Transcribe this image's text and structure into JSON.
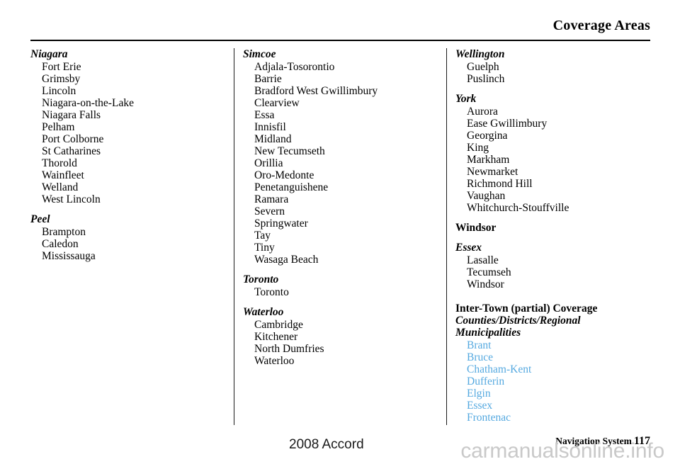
{
  "header": {
    "title": "Coverage Areas"
  },
  "columns": [
    {
      "id": "left",
      "sections": [
        {
          "heading": "Niagara",
          "heading_style": "county",
          "items": [
            "Fort Erie",
            "Grimsby",
            "Lincoln",
            "Niagara-on-the-Lake",
            "Niagara Falls",
            "Pelham",
            "Port Colborne",
            "St Catharines",
            "Thorold",
            "Wainfleet",
            "Welland",
            "West Lincoln"
          ]
        },
        {
          "heading": "Peel",
          "heading_style": "county",
          "items": [
            "Brampton",
            "Caledon",
            "Mississauga"
          ]
        }
      ]
    },
    {
      "id": "middle",
      "sections": [
        {
          "heading": "Simcoe",
          "heading_style": "county",
          "items": [
            "Adjala-Tosorontio",
            "Barrie",
            "Bradford West Gwillimbury",
            "Clearview",
            "Essa",
            "Innisfil",
            "Midland",
            "New Tecumseth",
            "Orillia",
            "Oro-Medonte",
            "Penetanguishene",
            "Ramara",
            "Severn",
            "Springwater",
            "Tay",
            "Tiny",
            "Wasaga Beach"
          ]
        },
        {
          "heading": "Toronto",
          "heading_style": "county",
          "items": [
            "Toronto"
          ]
        },
        {
          "heading": "Waterloo",
          "heading_style": "county",
          "items": [
            "Cambridge",
            "Kitchener",
            "North Dumfries",
            "Waterloo"
          ]
        }
      ]
    },
    {
      "id": "right",
      "sections": [
        {
          "heading": "Wellington",
          "heading_style": "county",
          "items": [
            "Guelph",
            "Puslinch"
          ]
        },
        {
          "heading": "York",
          "heading_style": "county",
          "items": [
            "Aurora",
            "Ease Gwillimbury",
            "Georgina",
            "King",
            "Markham",
            "Newmarket",
            "Richmond Hill",
            "Vaughan",
            "Whitchurch-Stouffville"
          ]
        },
        {
          "heading": "Windsor",
          "heading_style": "region",
          "items": []
        },
        {
          "heading": "Essex",
          "heading_style": "county",
          "items": [
            "Lasalle",
            "Tecumseh",
            "Windsor"
          ]
        },
        {
          "heading": "Inter-Town (partial) Coverage",
          "heading_style": "block",
          "subheading_lines": [
            "Counties/Districts/Regional",
            "Municipalities"
          ],
          "items": [
            "Brant",
            "Bruce",
            "Chatham-Kent",
            "Dufferin",
            "Elgin",
            "Essex",
            "Frontenac"
          ],
          "item_style": "link"
        }
      ]
    }
  ],
  "footer": {
    "model": "2008  Accord",
    "nav_label": "Navigation System",
    "page_number": "117",
    "watermark": "carmanualsonline.info"
  },
  "colors": {
    "link": "#55a9e0",
    "text": "#000000",
    "watermark": "#c9c9c9",
    "rule": "#000000"
  }
}
